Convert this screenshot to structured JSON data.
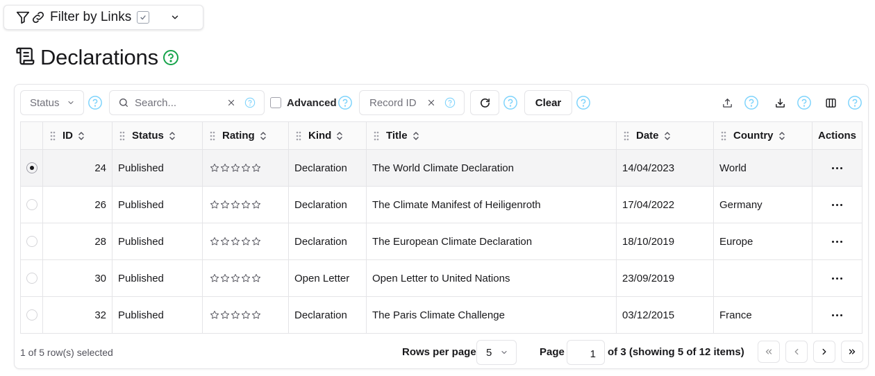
{
  "filter": {
    "label": "Filter by Links",
    "checked": true
  },
  "page": {
    "title": "Declarations"
  },
  "toolbar": {
    "status_placeholder": "Status",
    "search_placeholder": "Search...",
    "advanced_label": "Advanced",
    "record_id_placeholder": "Record ID",
    "clear_label": "Clear"
  },
  "table": {
    "columns": {
      "id": "ID",
      "status": "Status",
      "rating": "Rating",
      "kind": "Kind",
      "title": "Title",
      "date": "Date",
      "country": "Country",
      "actions": "Actions"
    },
    "rows": [
      {
        "selected": true,
        "id": "24",
        "status": "Published",
        "rating": 0,
        "kind": "Declaration",
        "title": "The World Climate Declaration",
        "date": "14/04/2023",
        "country": "World"
      },
      {
        "selected": false,
        "id": "26",
        "status": "Published",
        "rating": 0,
        "kind": "Declaration",
        "title": "The Climate Manifest of Heiligenroth",
        "date": "17/04/2022",
        "country": "Germany"
      },
      {
        "selected": false,
        "id": "28",
        "status": "Published",
        "rating": 0,
        "kind": "Declaration",
        "title": "The European Climate Declaration",
        "date": "18/10/2019",
        "country": "Europe"
      },
      {
        "selected": false,
        "id": "30",
        "status": "Published",
        "rating": 0,
        "kind": "Open Letter",
        "title": "Open Letter to United Nations",
        "date": "23/09/2019",
        "country": ""
      },
      {
        "selected": false,
        "id": "32",
        "status": "Published",
        "rating": 0,
        "kind": "Declaration",
        "title": "The Paris Climate Challenge",
        "date": "03/12/2015",
        "country": "France"
      }
    ]
  },
  "footer": {
    "selection_text": "1 of 5 row(s) selected",
    "rows_per_page_label": "Rows per page",
    "rows_per_page_value": "5",
    "page_label": "Page",
    "page_value": "1",
    "page_info": "of 3 (showing 5 of 12 items)"
  },
  "colors": {
    "help_icon": "#7dd3fc",
    "title_help_icon": "#16a34a",
    "border": "#e4e4e7"
  },
  "icons": [
    "filter-icon",
    "link-icon",
    "checkbox-icon",
    "chevron-down-icon",
    "scroll-icon",
    "help-icon",
    "search-icon",
    "close-icon",
    "refresh-icon",
    "upload-icon",
    "download-icon",
    "columns-icon",
    "grip-icon",
    "sort-icon",
    "star-icon",
    "more-icon",
    "chevrons-left-icon",
    "chevron-left-icon",
    "chevron-right-icon",
    "chevrons-right-icon"
  ]
}
